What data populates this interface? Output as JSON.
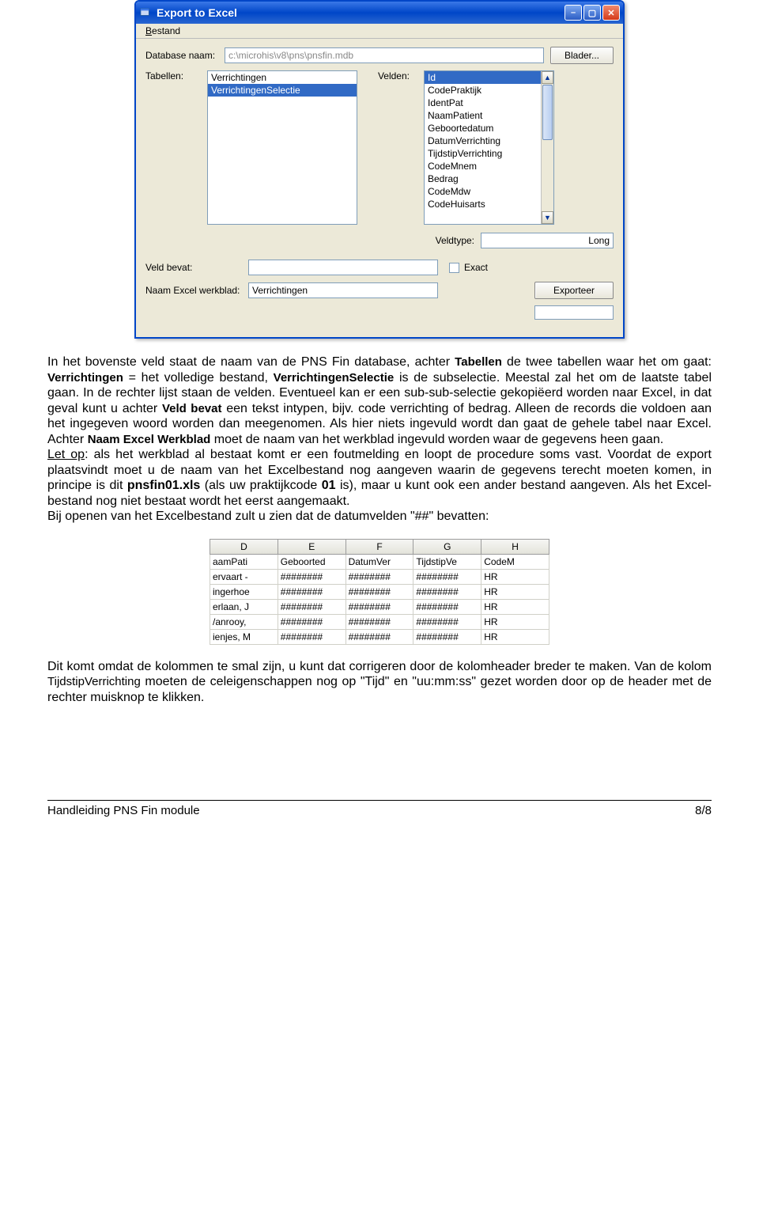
{
  "window": {
    "title": "Export to Excel",
    "menu_bestand": "Bestand",
    "db_label": "Database naam:",
    "db_path": "c:\\microhis\\v8\\pns\\pnsfin.mdb",
    "browse_btn": "Blader...",
    "tabellen_label": "Tabellen:",
    "tabellen": [
      "Verrichtingen",
      "VerrichtingenSelectie"
    ],
    "tabellen_selected_index": 1,
    "velden_label": "Velden:",
    "velden": [
      "Id",
      "CodePraktijk",
      "IdentPat",
      "NaamPatient",
      "Geboortedatum",
      "DatumVerrichting",
      "TijdstipVerrichting",
      "CodeMnem",
      "Bedrag",
      "CodeMdw",
      "CodeHuisarts"
    ],
    "velden_selected_index": 0,
    "veldtype_label": "Veldtype:",
    "veldtype_value": "Long",
    "veldbevat_label": "Veld bevat:",
    "exact_label": "Exact",
    "werkblad_label": "Naam Excel werkblad:",
    "werkblad_value": "Verrichtingen",
    "export_btn": "Exporteer"
  },
  "para1": {
    "t1": "In het bovenste veld staat de naam van de PNS Fin database, achter ",
    "tabellen": "Tabellen",
    "t2": " de twee tabellen waar het om gaat: ",
    "verr": "Verrichtingen",
    "t3": " = het volledige bestand, ",
    "verrsel": "VerrichtingenSelectie",
    "t4": " is de subselectie. Meestal zal het om de laatste tabel gaan. In de rechter lijst staan de velden. Eventueel kan er een sub-sub-selectie gekopiëerd worden naar Excel, in dat geval kunt u achter ",
    "veldbevat": "Veld bevat",
    "t5": " een tekst intypen, bijv. code verrichting of bedrag. Alleen de records die voldoen aan het ingegeven woord worden dan meegenomen. Als hier niets ingevuld wordt dan gaat de gehele tabel naar Excel. Achter ",
    "naamexcel": "Naam Excel Werkblad",
    "t6": " moet de naam van het werkblad ingevuld worden waar de gegevens heen gaan.",
    "letop_u": "Let op",
    "letop_rest": ": als het werkblad al bestaat komt er een foutmelding en loopt de procedure soms vast. Voordat de export plaatsvindt moet u de naam van het Excelbestand nog aangeven waarin de gegevens terecht moeten komen, in principe is dit ",
    "pnsfin": "pnsfin01.xls",
    "t7": " (als uw praktijkcode ",
    "code01": "01",
    "t8": " is), maar u kunt ook een ander bestand aangeven. Als het Excel-bestand nog niet bestaat wordt het eerst aangemaakt.",
    "bij_open": "Bij openen van het Excelbestand zult u zien dat de datumvelden \"##\" bevatten:"
  },
  "excel": {
    "col_letters": [
      "D",
      "E",
      "F",
      "G",
      "H"
    ],
    "headers": [
      "aamPati",
      "Geboorted",
      "DatumVer",
      "TijdstipVe",
      "CodeM"
    ],
    "rows": [
      [
        "ervaart -",
        "########",
        "########",
        "########",
        "HR"
      ],
      [
        "ingerhoe",
        "########",
        "########",
        "########",
        "HR"
      ],
      [
        "erlaan, J",
        "########",
        "########",
        "########",
        "HR"
      ],
      [
        "/anrooy,",
        "########",
        "########",
        "########",
        "HR"
      ],
      [
        "ienjes, M",
        "########",
        "########",
        "########",
        "HR"
      ]
    ]
  },
  "para2": {
    "t1": "Dit komt omdat de kolommen te smal zijn, u kunt dat corrigeren door de kolomheader breder te maken. Van de kolom ",
    "tijdstip": "TijdstipVerrichting",
    "t2": " moeten de celeigenschappen nog op \"Tijd\" en \"uu:mm:ss\" gezet worden door op de header met de rechter muisknop te klikken."
  },
  "footer": {
    "left": "Handleiding PNS Fin module",
    "right": "8/8"
  }
}
